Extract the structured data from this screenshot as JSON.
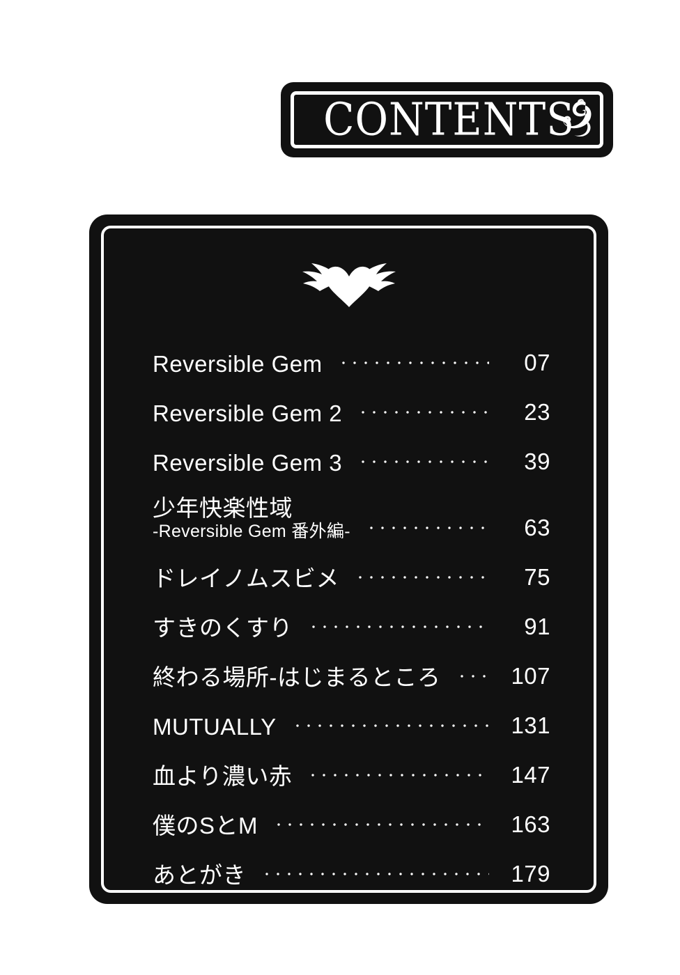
{
  "page": {
    "background_color": "#ffffff",
    "panel_color": "#111111",
    "text_color": "#ffffff"
  },
  "header": {
    "title": "CONTENTS",
    "flourish_icon": "curl-flourish-icon"
  },
  "toc": {
    "ornament_icon": "winged-heart-icon",
    "entries": [
      {
        "title": "Reversible Gem",
        "subtitle": "",
        "page": "07"
      },
      {
        "title": "Reversible Gem 2",
        "subtitle": "",
        "page": "23"
      },
      {
        "title": "Reversible Gem 3",
        "subtitle": "",
        "page": "39"
      },
      {
        "title": "少年快楽性域",
        "subtitle": "-Reversible Gem 番外編-",
        "page": "63"
      },
      {
        "title": "ドレイノムスビメ",
        "subtitle": "",
        "page": "75"
      },
      {
        "title": "すきのくすり",
        "subtitle": "",
        "page": "91"
      },
      {
        "title": "終わる場所-はじまるところ",
        "subtitle": "",
        "page": "107"
      },
      {
        "title": "MUTUALLY",
        "subtitle": "",
        "page": "131"
      },
      {
        "title": "血より濃い赤",
        "subtitle": "",
        "page": "147"
      },
      {
        "title": "僕のSとM",
        "subtitle": "",
        "page": "163"
      },
      {
        "title": "あとがき",
        "subtitle": "",
        "page": "179"
      }
    ]
  }
}
